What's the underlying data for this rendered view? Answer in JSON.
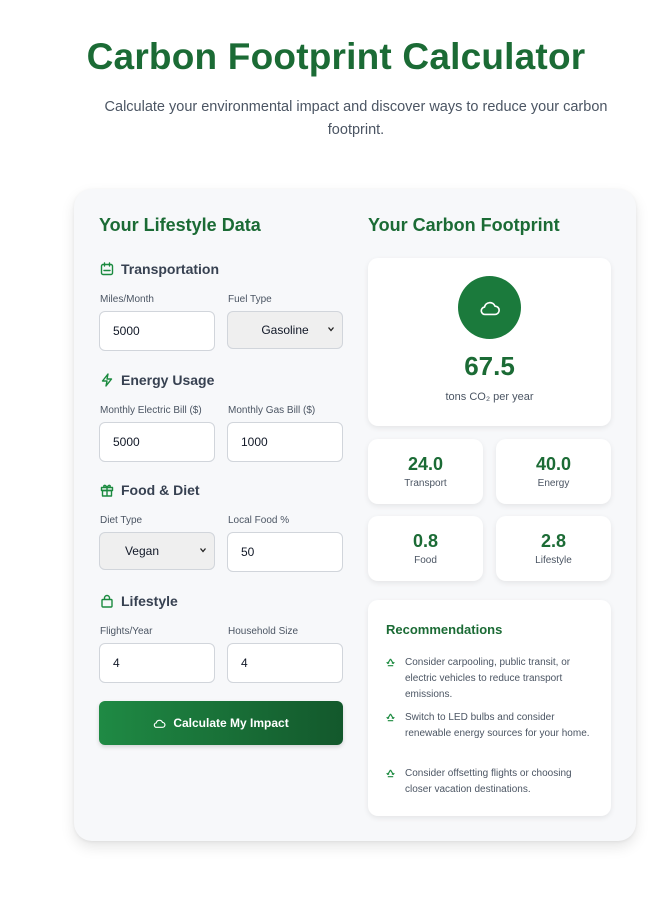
{
  "header": {
    "title": "Carbon Footprint Calculator",
    "subtitle": "Calculate your environmental impact and discover ways to reduce your carbon footprint."
  },
  "colors": {
    "accent": "#1b6b35",
    "button_start": "#1f8a44",
    "button_end": "#13582c",
    "card_bg": "#f7f8fa"
  },
  "form": {
    "title": "Your Lifestyle Data",
    "transportation": {
      "heading": "Transportation",
      "icon": "calendar-icon",
      "miles_label": "Miles/Month",
      "miles_value": "5000",
      "fuel_label": "Fuel Type",
      "fuel_value": "Gasoline"
    },
    "energy": {
      "heading": "Energy Usage",
      "icon": "lightning-icon",
      "electric_label": "Monthly Electric Bill ($)",
      "electric_value": "5000",
      "gas_label": "Monthly Gas Bill ($)",
      "gas_value": "1000"
    },
    "food": {
      "heading": "Food & Diet",
      "icon": "gift-icon",
      "diet_label": "Diet Type",
      "diet_value": "Vegan",
      "local_label": "Local Food %",
      "local_value": "50"
    },
    "lifestyle": {
      "heading": "Lifestyle",
      "icon": "shopping-bag-icon",
      "flights_label": "Flights/Year",
      "flights_value": "4",
      "household_label": "Household Size",
      "household_value": "4"
    },
    "button_label": "Calculate My Impact"
  },
  "results": {
    "title": "Your Carbon Footprint",
    "icon": "cloud-icon",
    "total": "67.5",
    "unit": "tons CO₂ per year",
    "breakdown": [
      {
        "value": "24.0",
        "label": "Transport"
      },
      {
        "value": "40.0",
        "label": "Energy"
      },
      {
        "value": "0.8",
        "label": "Food"
      },
      {
        "value": "2.8",
        "label": "Lifestyle"
      }
    ],
    "recommendations": {
      "title": "Recommendations",
      "icon": "recycle-icon",
      "items": [
        "Consider carpooling, public transit, or electric vehicles to reduce transport emissions.",
        "Switch to LED bulbs and consider renewable energy sources for your home.",
        "Consider offsetting flights or choosing closer vacation destinations."
      ]
    }
  }
}
